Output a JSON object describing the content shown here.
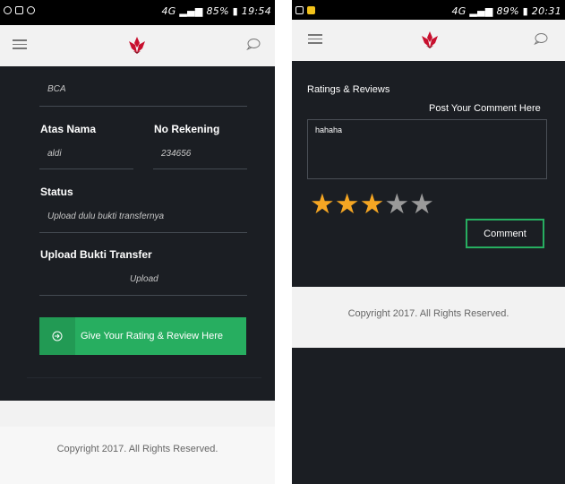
{
  "left_screen": {
    "status_time": "19:54",
    "status_battery": "85%",
    "status_network": "4G",
    "bank_value": "BCA",
    "atas_nama_label": "Atas Nama",
    "atas_nama_value": "aldi",
    "no_rekening_label": "No Rekening",
    "no_rekening_value": "234656",
    "status_label": "Status",
    "status_value": "Upload dulu bukti transfernya",
    "upload_label": "Upload Bukti Transfer",
    "upload_value": "Upload",
    "rating_button_label": "Give Your Rating & Review Here",
    "footer_text": "Copyright 2017. All Rights Reserved."
  },
  "right_screen": {
    "status_time": "20:31",
    "status_battery": "89%",
    "status_network": "4G",
    "section_title": "Ratings & Reviews",
    "post_label": "Post Your Comment Here",
    "comment_value": "hahaha",
    "rating": 3,
    "rating_max": 5,
    "comment_button_label": "Comment",
    "footer_text": "Copyright 2017. All Rights Reserved."
  },
  "icons": {
    "menu": "menu-icon",
    "logo": "lotus-logo-icon",
    "chat": "chat-bubble-icon",
    "upload": "upload-arrow-icon",
    "star": "star-icon"
  },
  "colors": {
    "dark_bg": "#1b1e23",
    "appbar_bg": "#f2f2f2",
    "accent_green": "#27ae60",
    "logo_red": "#c8102e",
    "star_filled": "#f5a623",
    "star_empty": "#9a9a9a"
  }
}
